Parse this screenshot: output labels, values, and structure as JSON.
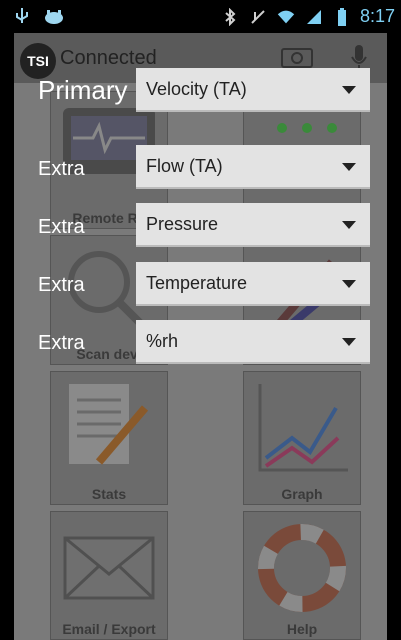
{
  "status": {
    "time": "8:17",
    "icons": [
      "usb-icon",
      "android-icon",
      "bluetooth-icon",
      "mute-icon",
      "wifi-icon",
      "signal-icon",
      "battery-icon"
    ]
  },
  "app": {
    "title": "Connected"
  },
  "tiles": {
    "remote": "Remote Re",
    "scan": "Scan devi",
    "stats": "Stats",
    "graph": "Graph",
    "email": "Email / Export",
    "help": "Help"
  },
  "rows": [
    {
      "label": "Primary",
      "value": "Velocity (TA)"
    },
    {
      "label": "Extra",
      "value": "Flow (TA)"
    },
    {
      "label": "Extra",
      "value": "Pressure"
    },
    {
      "label": "Extra",
      "value": "Temperature"
    },
    {
      "label": "Extra",
      "value": "%rh"
    }
  ]
}
